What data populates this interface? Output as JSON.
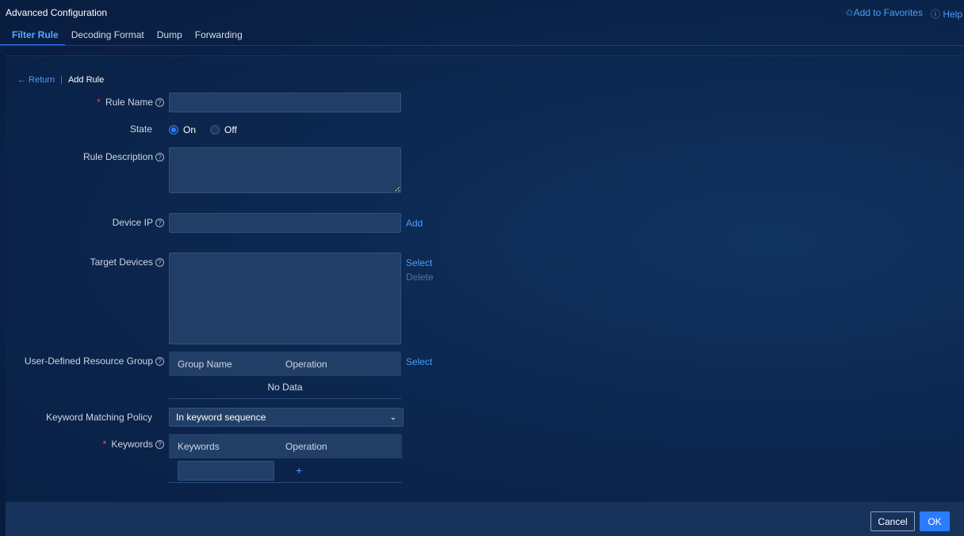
{
  "header": {
    "title": "Advanced Configuration",
    "add_favorites": "✩Add to Favorites",
    "help": "ⓘ Help"
  },
  "tabs": [
    {
      "label": "Filter Rule",
      "active": true
    },
    {
      "label": "Decoding Format",
      "active": false
    },
    {
      "label": "Dump",
      "active": false
    },
    {
      "label": "Forwarding",
      "active": false
    }
  ],
  "breadcrumb": {
    "return_label": "← Return",
    "separator": "|",
    "current": "Add Rule"
  },
  "form": {
    "rule_name": {
      "label": "Rule Name",
      "required": true,
      "value": ""
    },
    "state": {
      "label": "State",
      "options": [
        "On",
        "Off"
      ],
      "selected": "On"
    },
    "rule_description": {
      "label": "Rule Description",
      "value": ""
    },
    "device_ip": {
      "label": "Device IP",
      "value": "",
      "action": "Add"
    },
    "target_devices": {
      "label": "Target Devices",
      "action_select": "Select",
      "action_delete": "Delete"
    },
    "resource_group": {
      "label": "User-Defined Resource Group",
      "action": "Select",
      "columns": [
        "Group Name",
        "Operation"
      ],
      "empty_text": "No Data"
    },
    "keyword_policy": {
      "label": "Keyword Matching Policy",
      "value": "In keyword sequence"
    },
    "keywords": {
      "label": "Keywords",
      "required": true,
      "columns": [
        "Keywords",
        "Operation"
      ],
      "add_symbol": "+"
    }
  },
  "footer": {
    "cancel": "Cancel",
    "ok": "OK"
  },
  "colors": {
    "accent": "#2b7cff",
    "link": "#4b9dff",
    "required": "#ff4d4f",
    "background": "#0a2146"
  }
}
